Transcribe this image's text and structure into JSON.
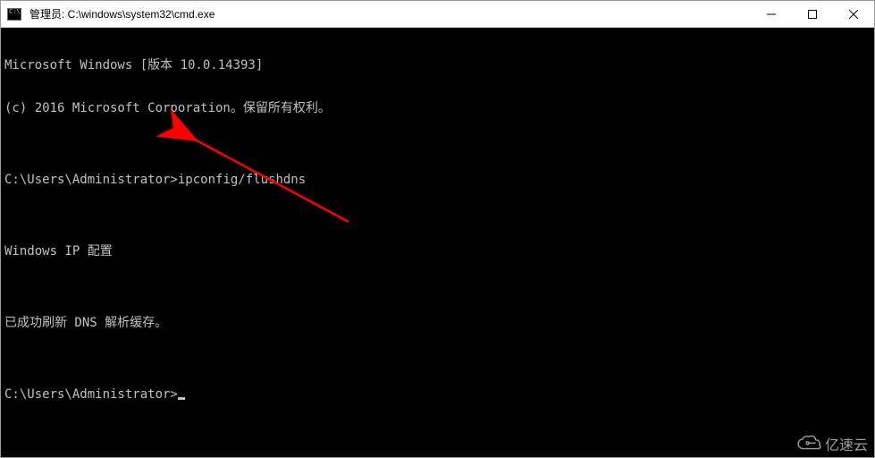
{
  "titlebar": {
    "title": "管理员: C:\\windows\\system32\\cmd.exe",
    "min_label": "Minimize",
    "max_label": "Maximize",
    "close_label": "Close"
  },
  "terminal": {
    "line1": "Microsoft Windows [版本 10.0.14393]",
    "line2": "(c) 2016 Microsoft Corporation。保留所有权利。",
    "blank1": "",
    "prompt1_path": "C:\\Users\\Administrator>",
    "prompt1_cmd": "ipconfig/flushdns",
    "blank2": "",
    "line_ipcfg": "Windows IP 配置",
    "blank3": "",
    "line_success": "已成功刷新 DNS 解析缓存。",
    "blank4": "",
    "prompt2_path": "C:\\Users\\Administrator>"
  },
  "watermark": {
    "text": "亿速云"
  }
}
